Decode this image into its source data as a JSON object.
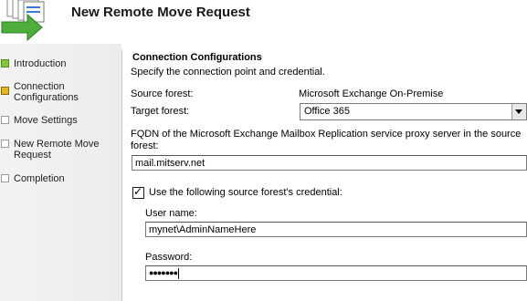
{
  "window": {
    "title": "New Remote Move Request"
  },
  "nav": {
    "items": [
      {
        "label": "Introduction",
        "state": "done"
      },
      {
        "label": "Connection Configurations",
        "state": "current"
      },
      {
        "label": "Move Settings",
        "state": "pending"
      },
      {
        "label": "New Remote Move Request",
        "state": "pending"
      },
      {
        "label": "Completion",
        "state": "pending"
      }
    ]
  },
  "main": {
    "section_title": "Connection Configurations",
    "section_desc": "Specify the connection point and credential.",
    "source_forest_label": "Source forest:",
    "source_forest_value": "Microsoft Exchange On-Premise",
    "target_forest_label": "Target forest:",
    "target_forest_selected": "Office 365",
    "fqdn_label": "FQDN of the Microsoft Exchange Mailbox Replication service proxy server in the source forest:",
    "fqdn_value": "mail.mitserv.net",
    "use_credential_label": "Use the following source forest's credential:",
    "use_credential_checked": true,
    "username_label": "User name:",
    "username_value": "mynet\\AdminNameHere",
    "password_label": "Password:",
    "password_masked": "●●●●●●●"
  },
  "colors": {
    "step_done": "#86c63c",
    "step_current": "#e6b81c"
  }
}
